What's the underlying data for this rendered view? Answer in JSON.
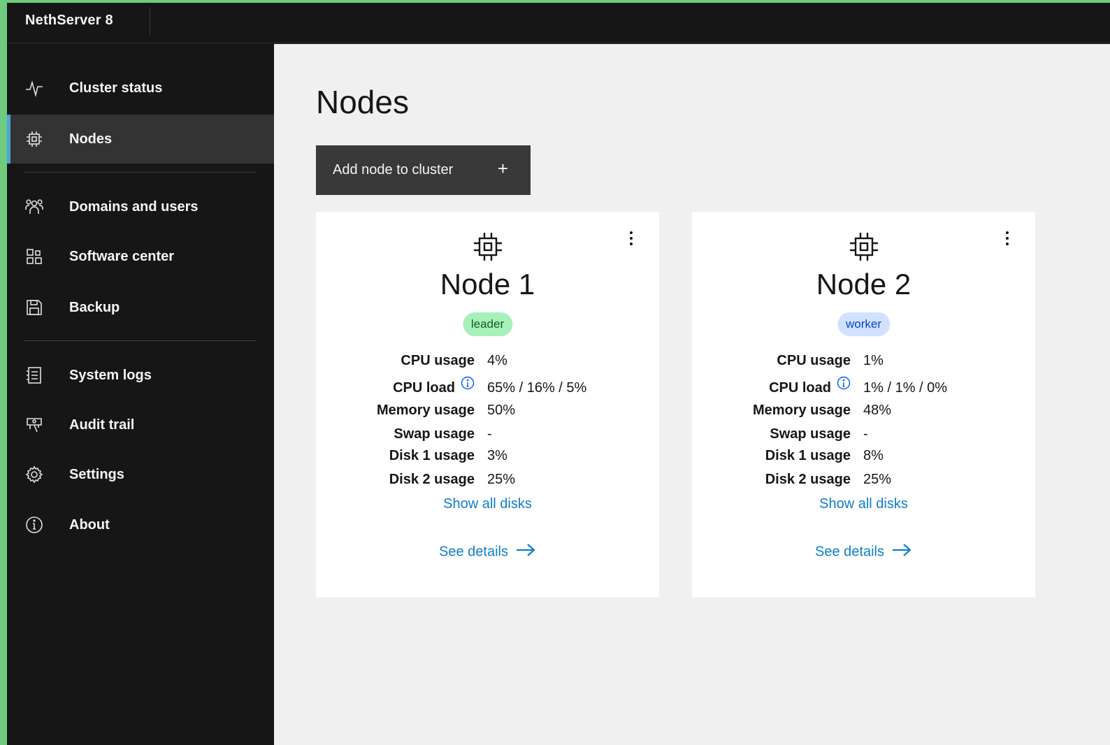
{
  "header": {
    "app_title": "NethServer 8"
  },
  "sidebar": {
    "items": [
      {
        "label": "Cluster status",
        "icon": "activity-icon"
      },
      {
        "label": "Nodes",
        "icon": "chip-icon",
        "active": true
      },
      {
        "label": "Domains and users",
        "icon": "users-icon"
      },
      {
        "label": "Software center",
        "icon": "apps-icon"
      },
      {
        "label": "Backup",
        "icon": "save-icon"
      },
      {
        "label": "System logs",
        "icon": "logs-icon"
      },
      {
        "label": "Audit trail",
        "icon": "audit-icon"
      },
      {
        "label": "Settings",
        "icon": "gear-icon"
      },
      {
        "label": "About",
        "icon": "info-icon"
      }
    ]
  },
  "main": {
    "title": "Nodes",
    "add_button": {
      "label": "Add node to cluster",
      "icon": "+"
    },
    "nodes": [
      {
        "title": "Node 1",
        "role": "leader",
        "stats": [
          {
            "label": "CPU usage",
            "value": "4%"
          },
          {
            "label": "CPU load",
            "value": "65% / 16% / 5%"
          },
          {
            "label": "Memory usage",
            "value": "50%"
          },
          {
            "label": "Swap usage",
            "value": "-"
          },
          {
            "label": "Disk 1 usage",
            "value": "3%"
          },
          {
            "label": "Disk 2 usage",
            "value": "25%"
          }
        ],
        "show_disks": "Show all disks",
        "see_details": "See details"
      },
      {
        "title": "Node 2",
        "role": "worker",
        "stats": [
          {
            "label": "CPU usage",
            "value": "1%"
          },
          {
            "label": "CPU load",
            "value": "1% / 1% / 0%"
          },
          {
            "label": "Memory usage",
            "value": "48%"
          },
          {
            "label": "Swap usage",
            "value": "-"
          },
          {
            "label": "Disk 1 usage",
            "value": "8%"
          },
          {
            "label": "Disk 2 usage",
            "value": "25%"
          }
        ],
        "show_disks": "Show all disks",
        "see_details": "See details"
      }
    ]
  },
  "colors": {
    "accent": "#4fa3d9",
    "link": "#0f7ec9",
    "leader_badge": "#a7f0ba",
    "worker_badge": "#d0e2ff"
  }
}
